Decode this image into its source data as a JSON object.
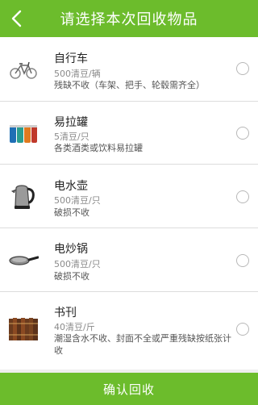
{
  "header": {
    "title": "请选择本次回收物品",
    "back_icon": "chevron-left-icon"
  },
  "items": [
    {
      "name": "自行车",
      "price": "500清豆/辆",
      "note": "残缺不收（车架、把手、轮毂需齐全）",
      "icon": "bicycle-icon"
    },
    {
      "name": "易拉罐",
      "price": "5清豆/只",
      "note": "各类酒类或饮料易拉罐",
      "icon": "cans-icon"
    },
    {
      "name": "电水壶",
      "price": "500清豆/只",
      "note": "破损不收",
      "icon": "kettle-icon"
    },
    {
      "name": "电炒锅",
      "price": "500清豆/只",
      "note": "破损不收",
      "icon": "frying-pan-icon"
    },
    {
      "name": "书刊",
      "price": "40清豆/斤",
      "note": "潮湿含水不收、封面不全或严重残缺按纸张计收",
      "icon": "books-icon"
    }
  ],
  "footer": {
    "confirm_label": "确认回收"
  },
  "colors": {
    "brand_green": "#6cbc2c"
  }
}
